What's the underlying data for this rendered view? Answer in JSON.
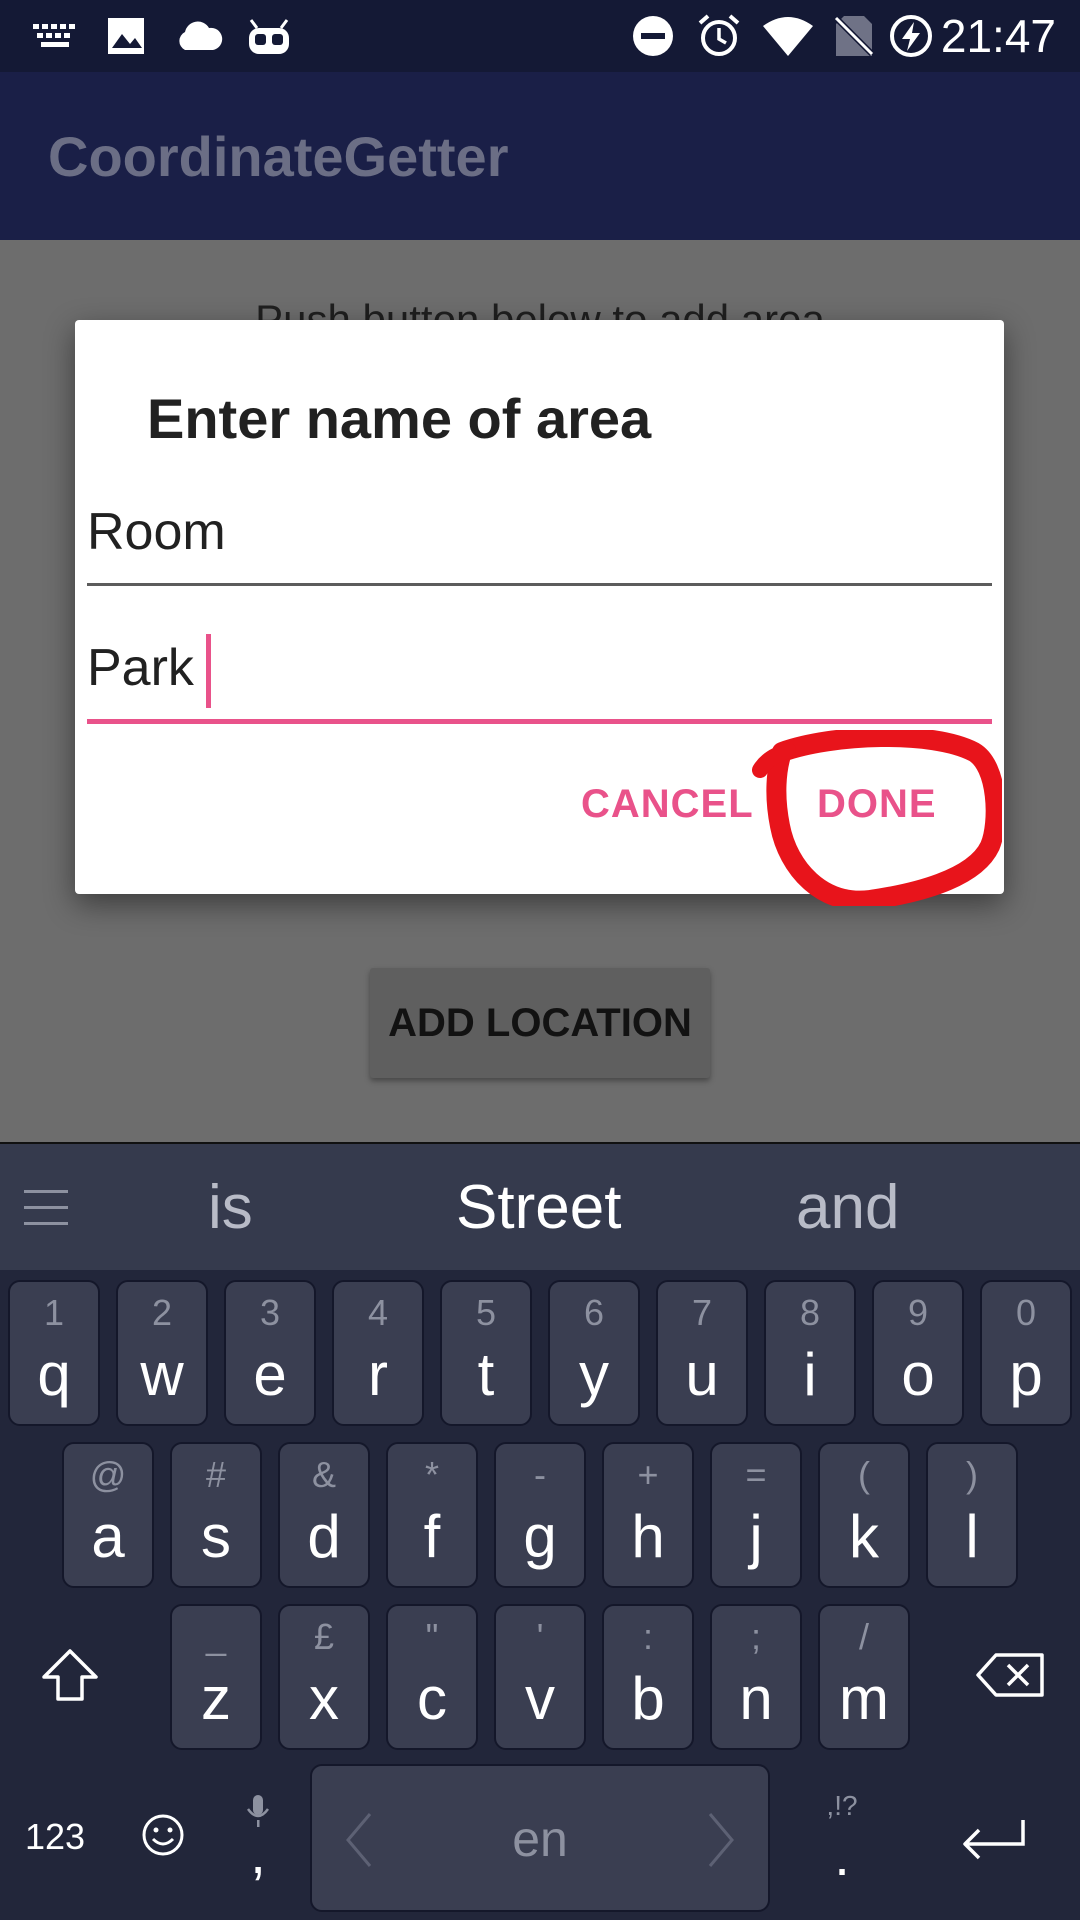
{
  "status_bar": {
    "time": "21:47",
    "icons": [
      "keyboard-icon",
      "image-icon",
      "cloud-icon",
      "cyanogen-mascot-icon",
      "do-not-disturb-icon",
      "alarm-icon",
      "wifi-icon",
      "no-sim-icon",
      "battery-charging-icon"
    ]
  },
  "app_bar": {
    "title": "CoordinateGetter"
  },
  "background": {
    "instruction": "Push button below to add area",
    "add_location_label": "ADD LOCATION"
  },
  "dialog": {
    "title": "Enter name of area",
    "field1_value": "Room",
    "field2_value": "Park",
    "cancel_label": "CANCEL",
    "done_label": "DONE",
    "accent_color": "#e9528a",
    "annotation_color": "#e8141b"
  },
  "keyboard": {
    "suggestions": [
      "is",
      "Street",
      "and"
    ],
    "rows": [
      [
        {
          "alt": "1",
          "key": "q"
        },
        {
          "alt": "2",
          "key": "w"
        },
        {
          "alt": "3",
          "key": "e"
        },
        {
          "alt": "4",
          "key": "r"
        },
        {
          "alt": "5",
          "key": "t"
        },
        {
          "alt": "6",
          "key": "y"
        },
        {
          "alt": "7",
          "key": "u"
        },
        {
          "alt": "8",
          "key": "i"
        },
        {
          "alt": "9",
          "key": "o"
        },
        {
          "alt": "0",
          "key": "p"
        }
      ],
      [
        {
          "alt": "@",
          "key": "a"
        },
        {
          "alt": "#",
          "key": "s"
        },
        {
          "alt": "&",
          "key": "d"
        },
        {
          "alt": "*",
          "key": "f"
        },
        {
          "alt": "-",
          "key": "g"
        },
        {
          "alt": "+",
          "key": "h"
        },
        {
          "alt": "=",
          "key": "j"
        },
        {
          "alt": "(",
          "key": "k"
        },
        {
          "alt": ")",
          "key": "l"
        }
      ],
      [
        {
          "alt": "_",
          "key": "z"
        },
        {
          "alt": "£",
          "key": "x"
        },
        {
          "alt": "\"",
          "key": "c"
        },
        {
          "alt": "'",
          "key": "v"
        },
        {
          "alt": ":",
          "key": "b"
        },
        {
          "alt": ";",
          "key": "n"
        },
        {
          "alt": "/",
          "key": "m"
        }
      ]
    ],
    "numbers_label": "123",
    "comma_label": ",",
    "space_label": "en",
    "period_label": ".",
    "period_alt": ",!?"
  }
}
